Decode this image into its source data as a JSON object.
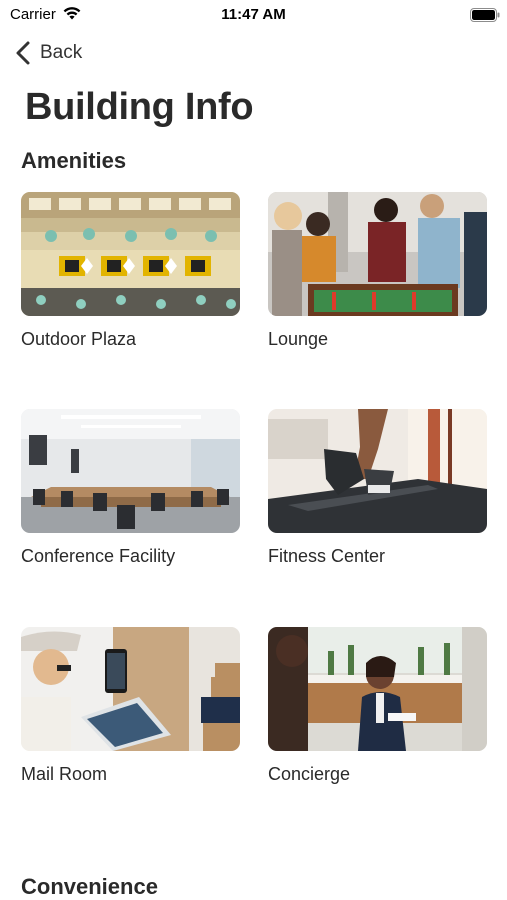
{
  "status_bar": {
    "carrier": "Carrier",
    "time": "11:47 AM",
    "wifi_icon": "wifi-icon",
    "battery_icon": "battery-icon"
  },
  "nav": {
    "back_label": "Back",
    "back_icon": "chevron-left-icon"
  },
  "page": {
    "title": "Building Info"
  },
  "sections": {
    "amenities": {
      "title": "Amenities",
      "cards": [
        {
          "label": "Outdoor Plaza"
        },
        {
          "label": "Lounge"
        },
        {
          "label": "Conference Facility"
        },
        {
          "label": "Fitness Center"
        },
        {
          "label": "Mail Room"
        },
        {
          "label": "Concierge"
        }
      ]
    },
    "convenience": {
      "title": "Convenience"
    }
  },
  "colors": {
    "title_text": "#2a2a2a",
    "background": "#ffffff"
  }
}
